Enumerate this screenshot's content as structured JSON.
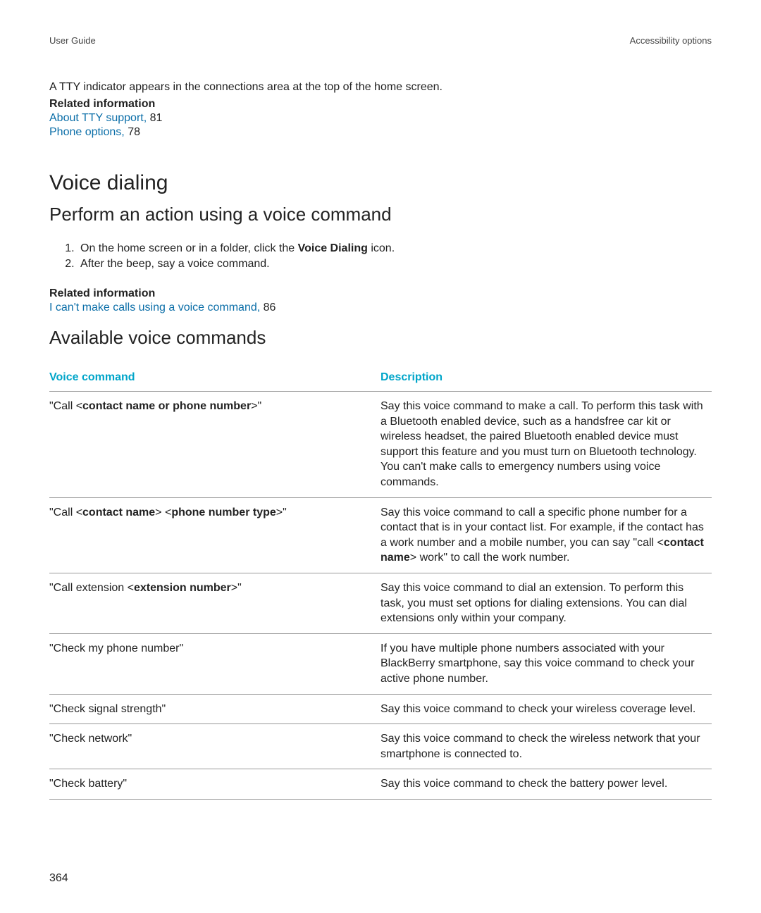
{
  "header": {
    "left": "User Guide",
    "right": "Accessibility options"
  },
  "intro": "A TTY indicator appears in the connections area at the top of the home screen.",
  "related1": {
    "heading": "Related information",
    "links": [
      {
        "text": "About TTY support,",
        "page": " 81"
      },
      {
        "text": "Phone options,",
        "page": " 78"
      }
    ]
  },
  "section_title": "Voice dialing",
  "sub1": "Perform an action using a voice command",
  "steps": {
    "s1a": "On the home screen or in a folder, click the ",
    "s1b": "Voice Dialing",
    "s1c": " icon.",
    "s2": "After the beep, say a voice command."
  },
  "related2": {
    "heading": "Related information",
    "links": [
      {
        "text": "I can't make calls using a voice command,",
        "page": " 86"
      }
    ]
  },
  "sub2": "Available voice commands",
  "table": {
    "headers": {
      "c1": "Voice command",
      "c2": "Description"
    },
    "rows": [
      {
        "cmd_pre": "\"Call <",
        "cmd_arg": "contact name or phone number",
        "cmd_post": ">\"",
        "desc": "Say this voice command to make a call. To perform this task with a Bluetooth enabled device, such as a handsfree car kit or wireless headset, the paired Bluetooth enabled device must support this feature and you must turn on Bluetooth technology. You can't make calls to emergency numbers using voice commands."
      },
      {
        "cmd_pre": "\"Call <",
        "cmd_arg": "contact name",
        "cmd_mid": "> <",
        "cmd_arg2": "phone number type",
        "cmd_post": ">\"",
        "desc_pre": "Say this voice command to call a specific phone number for a contact that is in your contact list. For example, if the contact has a work number and a mobile number, you can say \"call <",
        "desc_arg": "contact name",
        "desc_post": "> work\" to call the work number."
      },
      {
        "cmd_pre": "\"Call extension <",
        "cmd_arg": "extension number",
        "cmd_post": ">\"",
        "desc": "Say this voice command to dial an extension. To perform this task, you must set options for dialing extensions. You can dial extensions only within your company."
      },
      {
        "cmd_plain": "\"Check my phone number\"",
        "desc": "If you have multiple phone numbers associated with your BlackBerry smartphone, say this voice command to check your active phone number."
      },
      {
        "cmd_plain": "\"Check signal strength\"",
        "desc": "Say this voice command to check your wireless coverage level."
      },
      {
        "cmd_plain": "\"Check network\"",
        "desc": "Say this voice command to check the wireless network that your smartphone is connected to."
      },
      {
        "cmd_plain": "\"Check battery\"",
        "desc": "Say this voice command to check the battery power level."
      }
    ]
  },
  "page_number": "364"
}
